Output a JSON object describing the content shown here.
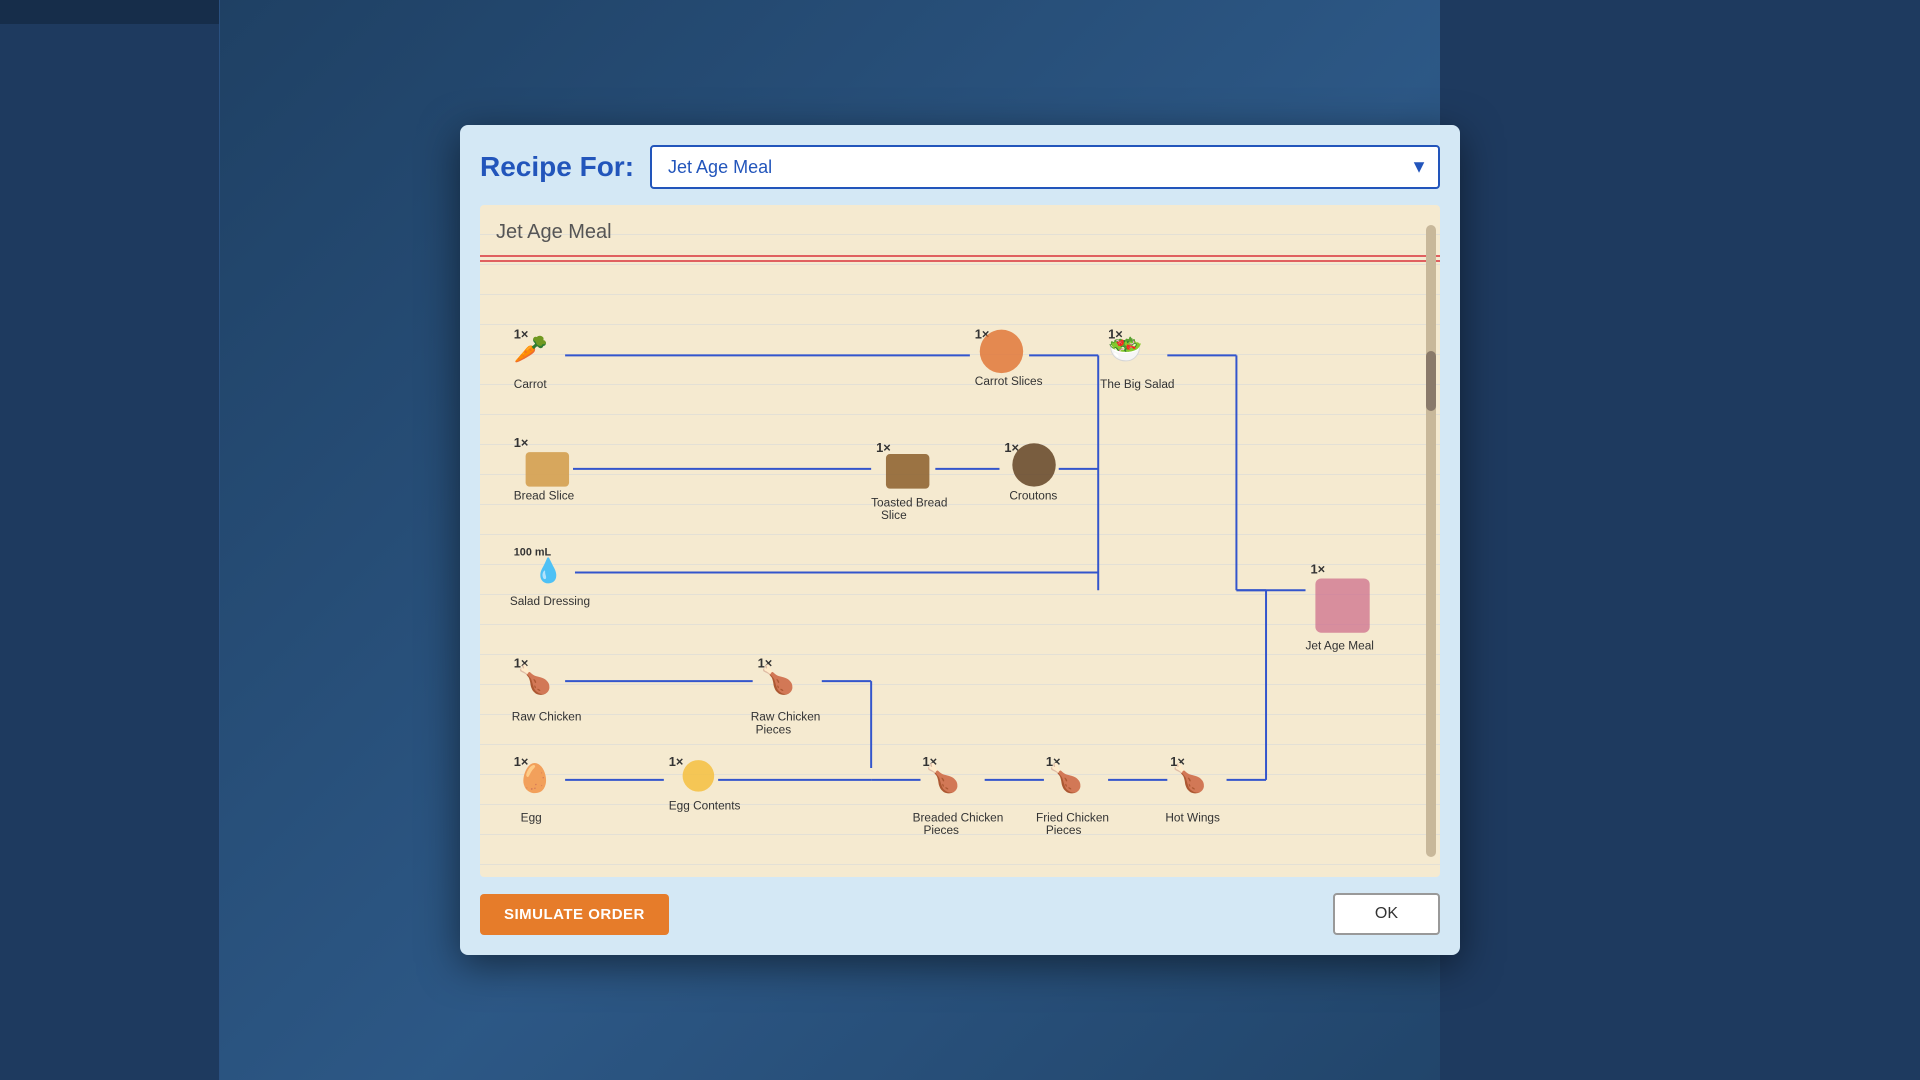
{
  "dialog": {
    "title": "Recipe For:",
    "dropdown": {
      "value": "Jet Age Meal",
      "options": [
        "Jet Age Meal"
      ]
    },
    "recipe_title": "Jet Age Meal",
    "buttons": {
      "simulate": "SIMULATE ORDER",
      "ok": "OK"
    }
  },
  "recipe": {
    "rows": [
      {
        "id": "row1",
        "ingredients": [
          {
            "qty": "1×",
            "label": "Carrot",
            "icon": "🥕"
          },
          {
            "qty": "1×",
            "label": "Carrot Slices",
            "icon": "🟠"
          },
          {
            "qty": "1×",
            "label": "The Big Salad",
            "icon": "🥗"
          }
        ]
      },
      {
        "id": "row2",
        "ingredients": [
          {
            "qty": "1×",
            "label": "Bread Slice",
            "icon": "🍞"
          },
          {
            "qty": "1×",
            "label": "Toasted Bread Slice",
            "icon": "🟫"
          },
          {
            "qty": "1×",
            "label": "Croutons",
            "icon": "🟤"
          }
        ]
      },
      {
        "id": "row3",
        "ingredients": [
          {
            "qty": "100 mL",
            "label": "Salad Dressing",
            "icon": "💧"
          }
        ]
      },
      {
        "id": "row4",
        "ingredients": [
          {
            "qty": "1×",
            "label": "Raw Chicken",
            "icon": "🍗"
          },
          {
            "qty": "1×",
            "label": "Raw Chicken Pieces",
            "icon": "🍗"
          }
        ]
      },
      {
        "id": "row5",
        "ingredients": [
          {
            "qty": "1×",
            "label": "Egg",
            "icon": "🥚"
          },
          {
            "qty": "1×",
            "label": "Egg Contents",
            "icon": "🟡"
          },
          {
            "qty": "1×",
            "label": "Breaded Chicken Pieces",
            "icon": "🍗"
          },
          {
            "qty": "1×",
            "label": "Fried Chicken Pieces",
            "icon": "🍗"
          },
          {
            "qty": "1×",
            "label": "Hot Wings",
            "icon": "🍗"
          }
        ]
      }
    ],
    "final_product": {
      "qty": "1×",
      "label": "Jet Age Meal",
      "icon": "📦"
    }
  }
}
